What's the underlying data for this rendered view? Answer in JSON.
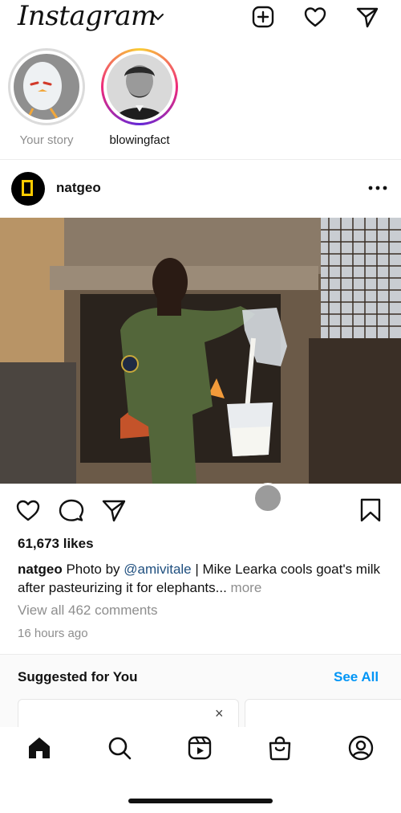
{
  "header": {
    "logo_text": "Instagram",
    "icons": [
      "chevron-down-icon",
      "new-post-icon",
      "heart-icon",
      "direct-message-icon"
    ]
  },
  "stories": [
    {
      "label": "Your story",
      "ring": "none"
    },
    {
      "label": "blowingfact",
      "ring": "unseen"
    }
  ],
  "post": {
    "username": "natgeo",
    "likes": "61,673 likes",
    "caption_user": "natgeo",
    "caption_pre": " Photo by ",
    "caption_mention": "@amivitale",
    "caption_post": " | Mike Learka cools goat's milk after pasteurizing it for elephants...",
    "caption_more": " more",
    "view_comments": "View all 462 comments",
    "time": "16 hours ago"
  },
  "suggested": {
    "title": "Suggested for You",
    "see_all": "See All",
    "dismiss": "×"
  },
  "nav": {
    "items": [
      "home-icon",
      "search-icon",
      "reels-icon",
      "shop-icon",
      "profile-icon"
    ]
  },
  "colors": {
    "link_blue": "#0095f6",
    "mention": "#1f4f7f",
    "muted": "#8e8e8e",
    "natgeo_yellow": "#ffcc00"
  }
}
